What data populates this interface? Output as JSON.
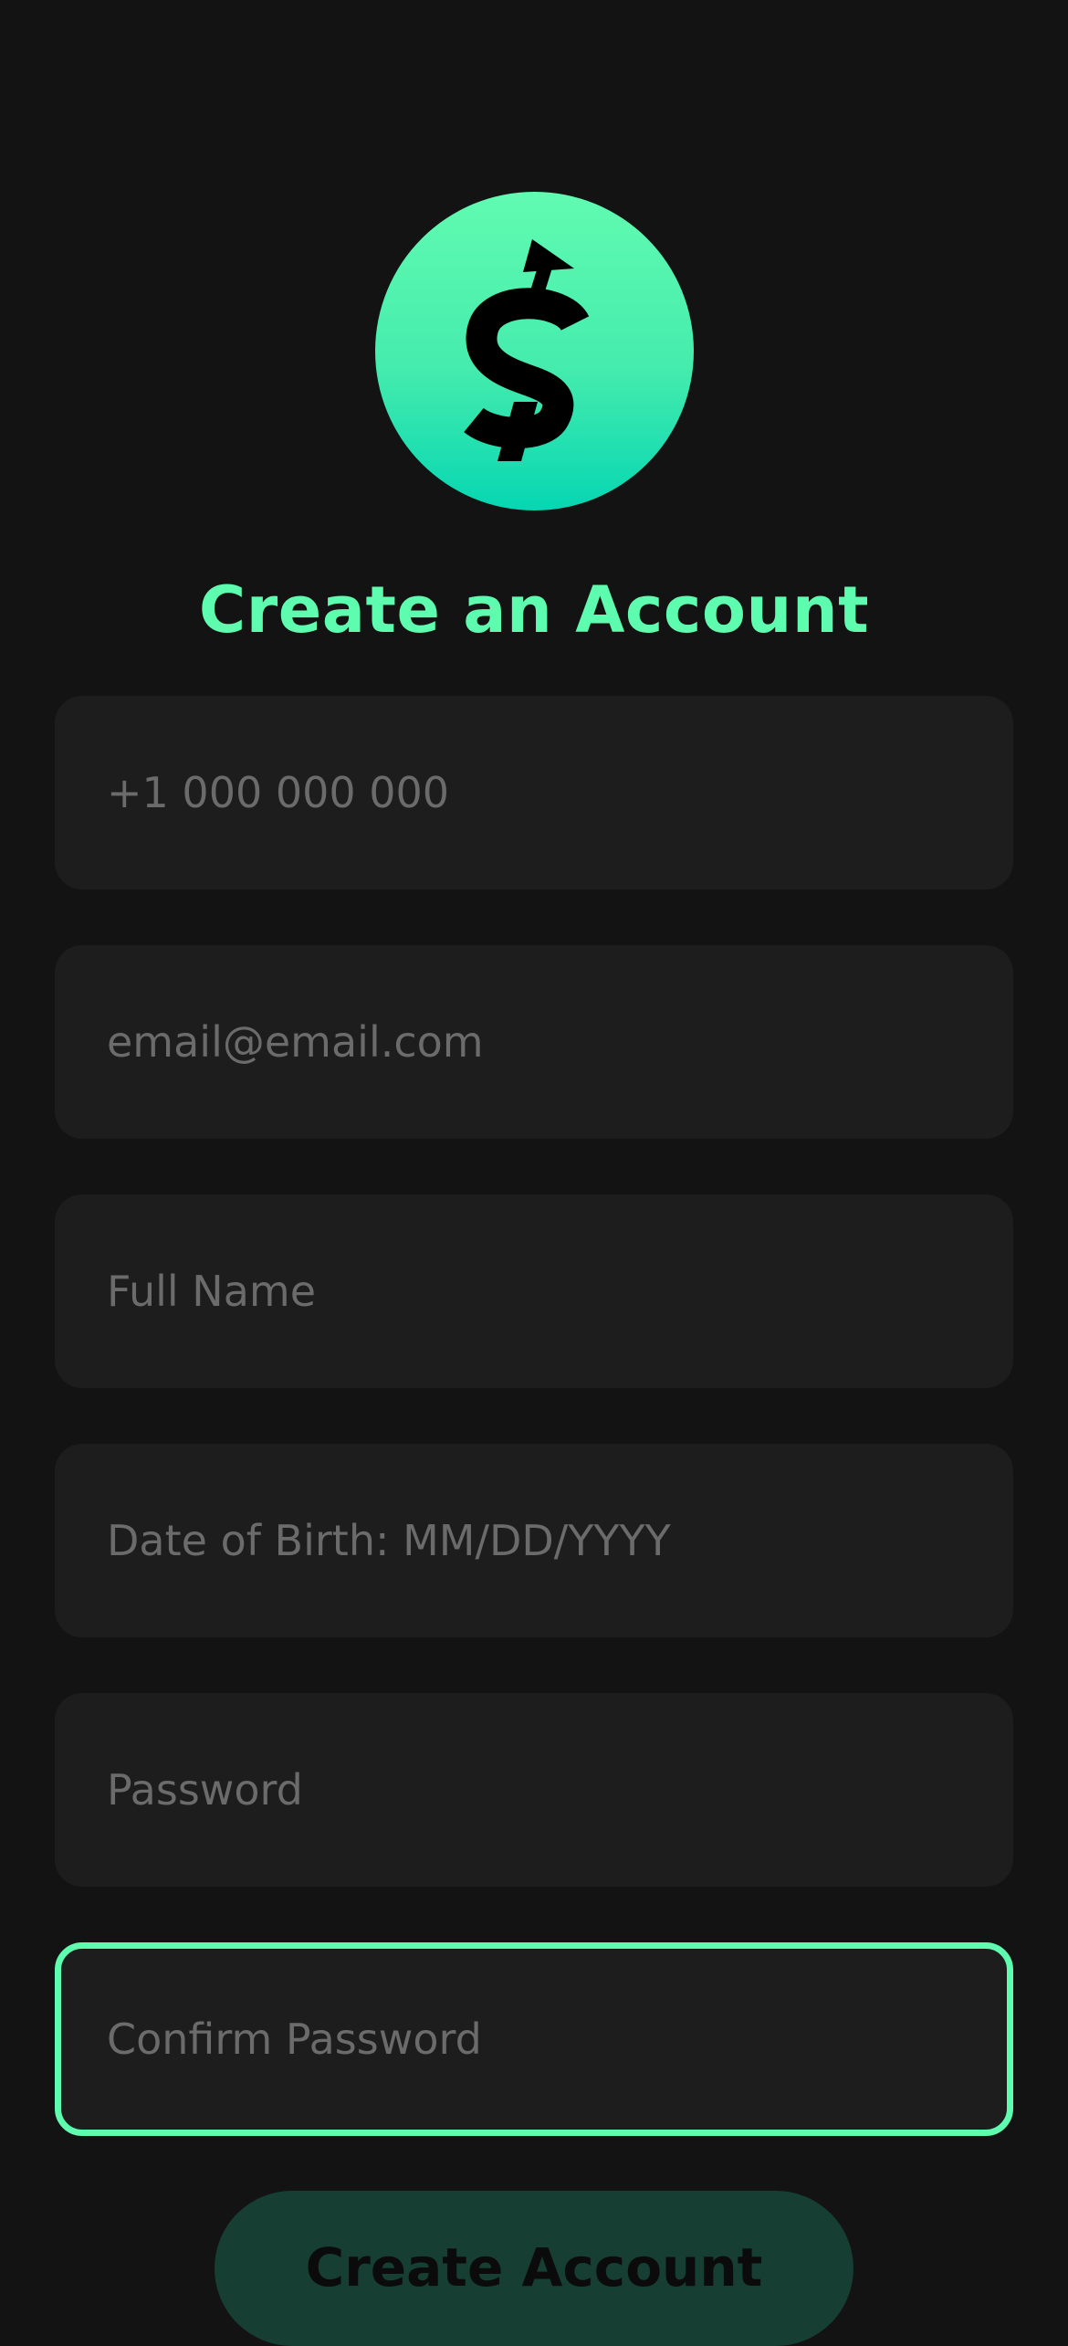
{
  "logo": {
    "icon": "dollar-up-arrow-icon",
    "gradient_top": "#61fbb1",
    "gradient_bottom": "#06d6b2"
  },
  "header": {
    "title": "Create an Account"
  },
  "form": {
    "phone": {
      "placeholder": "+1 000 000 000",
      "value": ""
    },
    "email": {
      "placeholder": "email@email.com",
      "value": ""
    },
    "full_name": {
      "placeholder": "Full Name",
      "value": ""
    },
    "dob": {
      "placeholder": "Date of Birth: MM/DD/YYYY",
      "value": ""
    },
    "password": {
      "placeholder": "Password",
      "value": ""
    },
    "confirm_password": {
      "placeholder": "Confirm Password",
      "value": "",
      "focused": true
    }
  },
  "actions": {
    "create_label": "Create Account"
  },
  "colors": {
    "background": "#131313",
    "field_background": "#1d1d1d",
    "accent": "#5efcae",
    "placeholder": "#6b6b6b",
    "button_background": "#173e33"
  }
}
